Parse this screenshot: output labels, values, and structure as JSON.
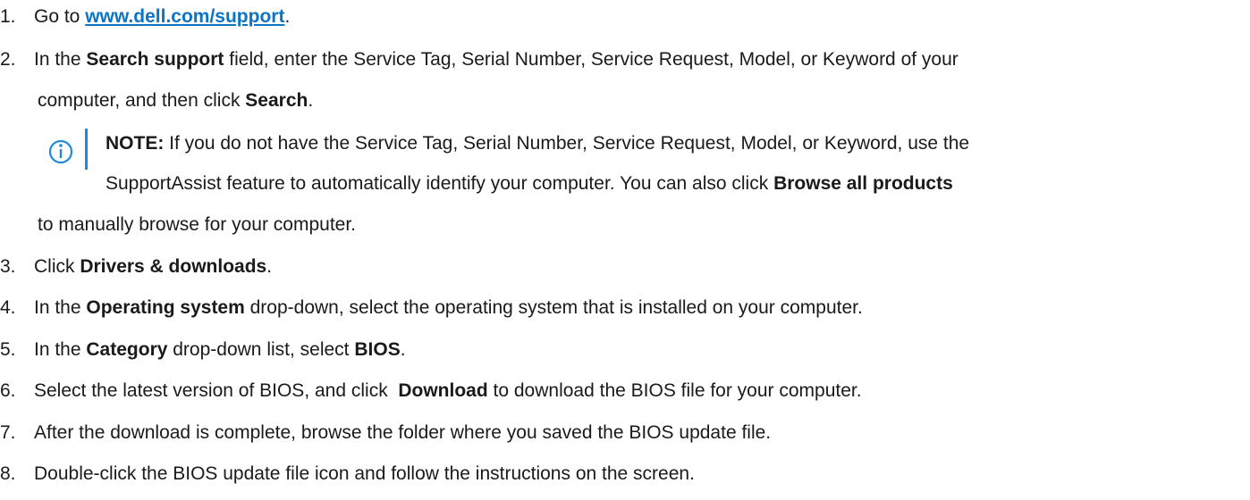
{
  "steps": [
    {
      "num": "1.",
      "parts": [
        {
          "t": "Go to "
        },
        {
          "t": "www.dell.com/support",
          "link": true
        },
        {
          "t": "."
        }
      ]
    },
    {
      "num": "2.",
      "parts": [
        {
          "t": "In the "
        },
        {
          "t": "Search support",
          "bold": true
        },
        {
          "t": " field, enter the Service Tag, Serial Number, Service Request, Model, or Keyword of your"
        }
      ],
      "cont": [
        {
          "t": "computer, and then click "
        },
        {
          "t": "Search",
          "bold": true
        },
        {
          "t": "."
        }
      ]
    },
    {
      "num": "3.",
      "parts": [
        {
          "t": "Click "
        },
        {
          "t": "Drivers & downloads",
          "bold": true
        },
        {
          "t": "."
        }
      ]
    },
    {
      "num": "4.",
      "parts": [
        {
          "t": "In the "
        },
        {
          "t": "Operating system",
          "bold": true
        },
        {
          "t": " drop-down, select the operating system that is installed on your computer."
        }
      ]
    },
    {
      "num": "5.",
      "parts": [
        {
          "t": "In the "
        },
        {
          "t": "Category",
          "bold": true
        },
        {
          "t": " drop-down list, select "
        },
        {
          "t": "BIOS",
          "bold": true
        },
        {
          "t": "."
        }
      ]
    },
    {
      "num": "6.",
      "parts": [
        {
          "t": "Select the latest version of BIOS, and click  "
        },
        {
          "t": "Download",
          "bold": true
        },
        {
          "t": " to download the BIOS file for your computer."
        }
      ]
    },
    {
      "num": "7.",
      "parts": [
        {
          "t": "After the download is complete, browse the folder where you saved the BIOS update file."
        }
      ]
    },
    {
      "num": "8.",
      "parts": [
        {
          "t": "Double-click the BIOS update file icon and follow the instructions on the screen."
        }
      ]
    }
  ],
  "note": {
    "line1": [
      {
        "t": "NOTE:",
        "bold": true
      },
      {
        "t": " If you do not have the Service Tag, Serial Number, Service Request, Model, or Keyword, use the"
      }
    ],
    "line2": [
      {
        "t": "SupportAssist feature to automatically identify your computer. You can also click "
      },
      {
        "t": "Browse all products",
        "bold": true
      }
    ],
    "line3": [
      {
        "t": "to manually browse for your computer."
      }
    ]
  },
  "colors": {
    "link": "#0b74c4",
    "icon": "#1f8ad8"
  },
  "icon": "info-icon"
}
